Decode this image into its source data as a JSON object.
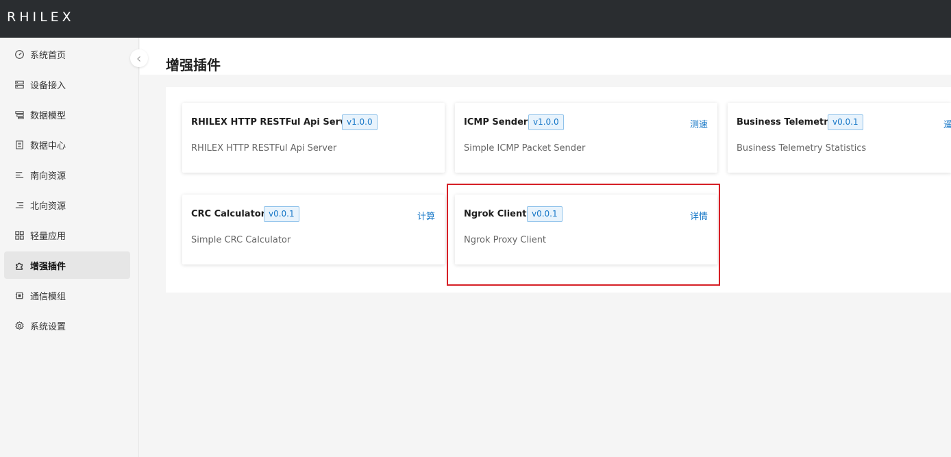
{
  "app": {
    "logo": "RHILEX"
  },
  "sidebar": {
    "items": [
      {
        "label": "系统首页",
        "icon": "dashboard-icon"
      },
      {
        "label": "设备接入",
        "icon": "device-icon"
      },
      {
        "label": "数据模型",
        "icon": "data-model-icon"
      },
      {
        "label": "数据中心",
        "icon": "data-center-icon"
      },
      {
        "label": "南向资源",
        "icon": "inbound-icon"
      },
      {
        "label": "北向资源",
        "icon": "outbound-icon"
      },
      {
        "label": "轻量应用",
        "icon": "apps-icon"
      },
      {
        "label": "增强插件",
        "icon": "plugin-icon",
        "active": true
      },
      {
        "label": "通信模组",
        "icon": "chip-icon"
      },
      {
        "label": "系统设置",
        "icon": "gear-icon"
      }
    ]
  },
  "page": {
    "title": "增强插件"
  },
  "plugins": [
    {
      "name": "RHILEX HTTP RESTFul Api Server",
      "version": "v1.0.0",
      "action": "",
      "description": "RHILEX HTTP RESTFul Api Server"
    },
    {
      "name": "ICMP Sender",
      "version": "v1.0.0",
      "action": "测速",
      "description": "Simple ICMP Packet Sender"
    },
    {
      "name": "Business Telemetry",
      "version": "v0.0.1",
      "action": "遥",
      "description": "Business Telemetry Statistics"
    },
    {
      "name": "CRC Calculator",
      "version": "v0.0.1",
      "action": "计算",
      "description": "Simple CRC Calculator"
    },
    {
      "name": "Ngrok Client",
      "version": "v0.0.1",
      "action": "详情",
      "description": "Ngrok Proxy Client"
    }
  ],
  "colors": {
    "accent": "#1677c7",
    "highlight": "#d61f26",
    "topbar": "#2a2d30"
  }
}
